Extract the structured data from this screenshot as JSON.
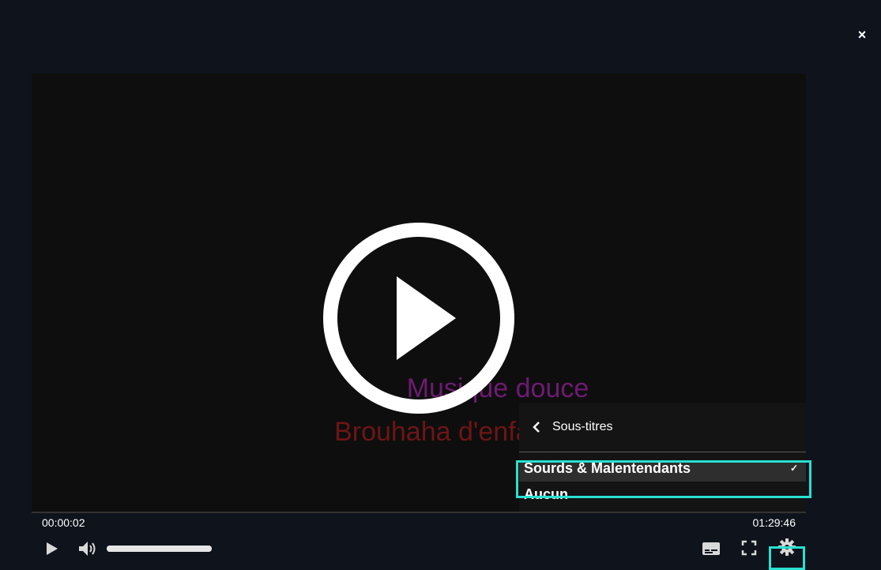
{
  "window": {
    "close_label": "×"
  },
  "video": {
    "subtitle_line1": "Musique douce",
    "subtitle_line2": "Brouhaha d'enfants",
    "subtitle_color1": "#6f1a73",
    "subtitle_color2": "#6e1515",
    "overlay_icon": "play-circle-icon"
  },
  "settings_menu": {
    "title": "Sous-titres",
    "back_icon": "chevron-left-icon",
    "items": [
      {
        "label": "Sourds & Malentendants",
        "selected": true,
        "check": "✓"
      },
      {
        "label": "Aucun",
        "selected": false
      }
    ]
  },
  "player": {
    "current_time": "00:00:02",
    "total_time": "01:29:46",
    "volume_level": 1.0,
    "icons": [
      "play-icon",
      "volume-icon",
      "subtitles-icon",
      "fullscreen-icon",
      "gear-icon"
    ]
  },
  "colors": {
    "background": "#0f131c",
    "highlight": "#28e0d0"
  }
}
